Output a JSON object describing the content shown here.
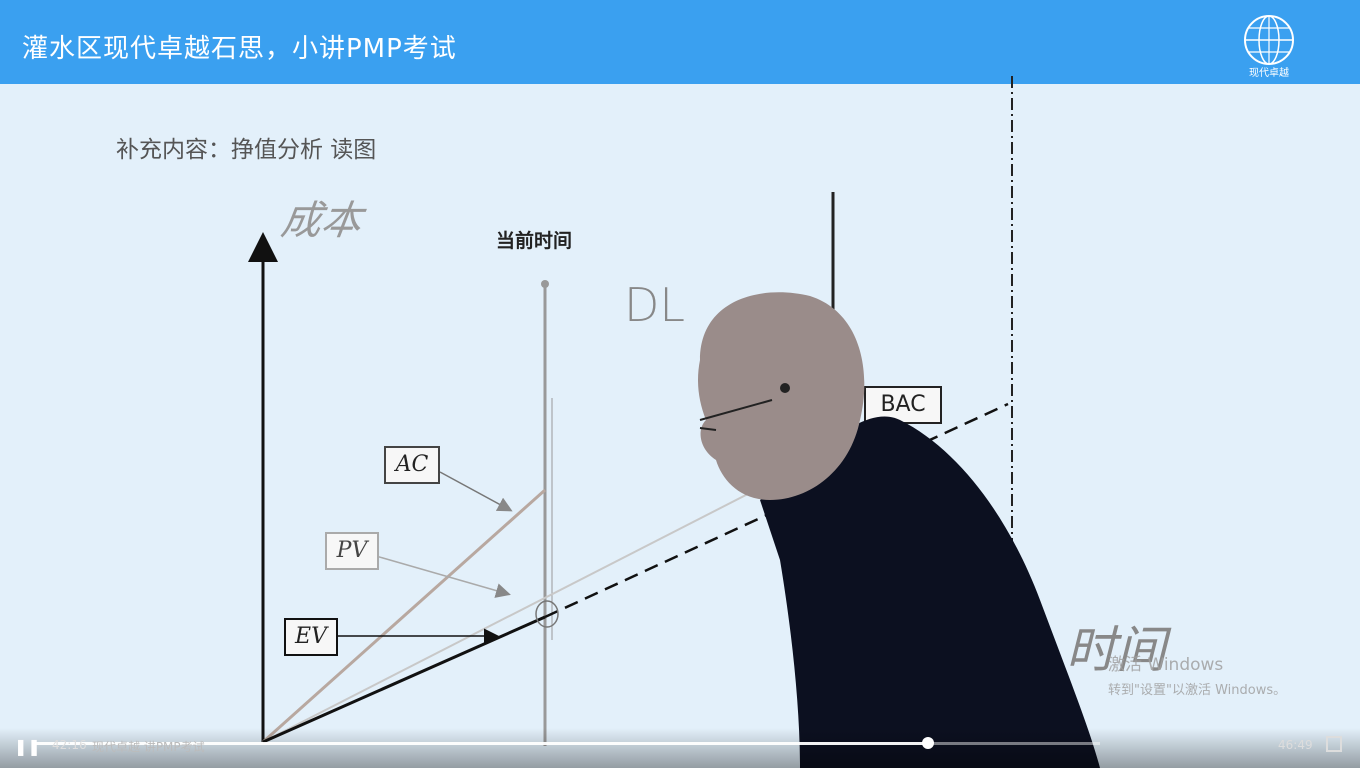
{
  "header": {
    "title": "灌水区现代卓越石思，小讲PMP考试",
    "logo_text": "现代卓越",
    "background": "#3aa0f0"
  },
  "slide": {
    "subtitle": "补充内容：挣值分析 读图",
    "handwritten_cost": "成本",
    "current_time_label": "当前时间",
    "handwritten_dl": "DL",
    "handwritten_time": "时间",
    "labels": {
      "ac": "AC",
      "pv": "PV",
      "ev": "EV",
      "bac": "BAC"
    }
  },
  "watermark": {
    "line1": "激活 Windows",
    "line2": "转到\"设置\"以激活 Windows。"
  },
  "player": {
    "time_elapsed": "42:16",
    "caption": "现代卓越 讲PMP考试",
    "time_total": "46:49",
    "progress": 0.838,
    "play_icon": "pause-icon",
    "fullscreen_icon": "fullscreen-icon"
  }
}
